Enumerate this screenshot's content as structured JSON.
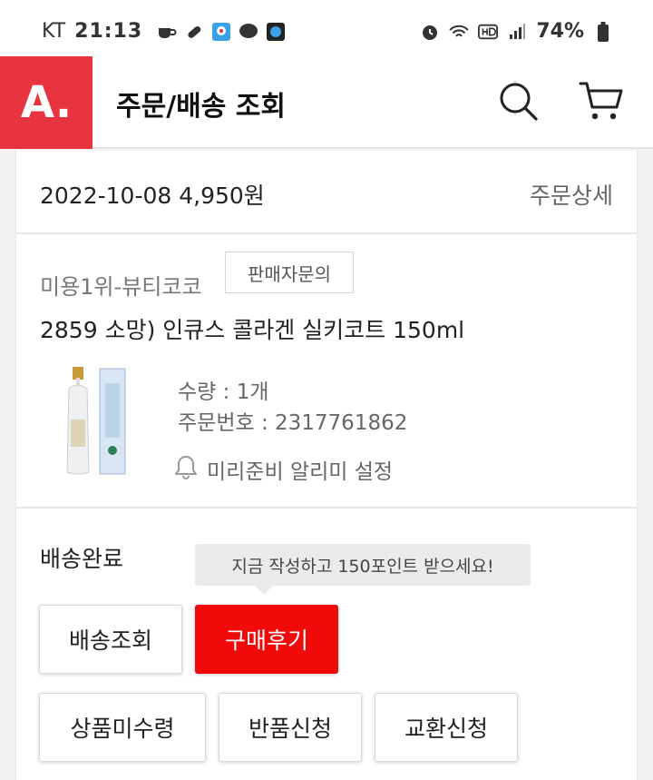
{
  "status_bar": {
    "carrier": "KT",
    "time": "21:13",
    "battery": "74%"
  },
  "header": {
    "logo": "A.",
    "title": "주문/배송 조회",
    "icons": [
      "search-icon",
      "cart-icon"
    ]
  },
  "order": {
    "date_price": "2022-10-08  4,950원",
    "detail_link": "주문상세",
    "seller": "미용1위-뷰티코코",
    "seller_button": "판매자문의",
    "product_name": "2859 소망) 인큐스 콜라겐 실키코트 150ml",
    "quantity": "수량 : 1개",
    "order_number": "주문번호 : 2317761862",
    "alarm_label": "미리준비 알리미 설정"
  },
  "delivery": {
    "status": "배송완료",
    "tooltip": "지금 작성하고 150포인트 받으세요!",
    "buttons": [
      "배송조회",
      "구매후기",
      "상품미수령",
      "반품신청",
      "교환신청"
    ]
  },
  "colors": {
    "brand": "#e8343e",
    "primary_button": "#f10a0a"
  }
}
